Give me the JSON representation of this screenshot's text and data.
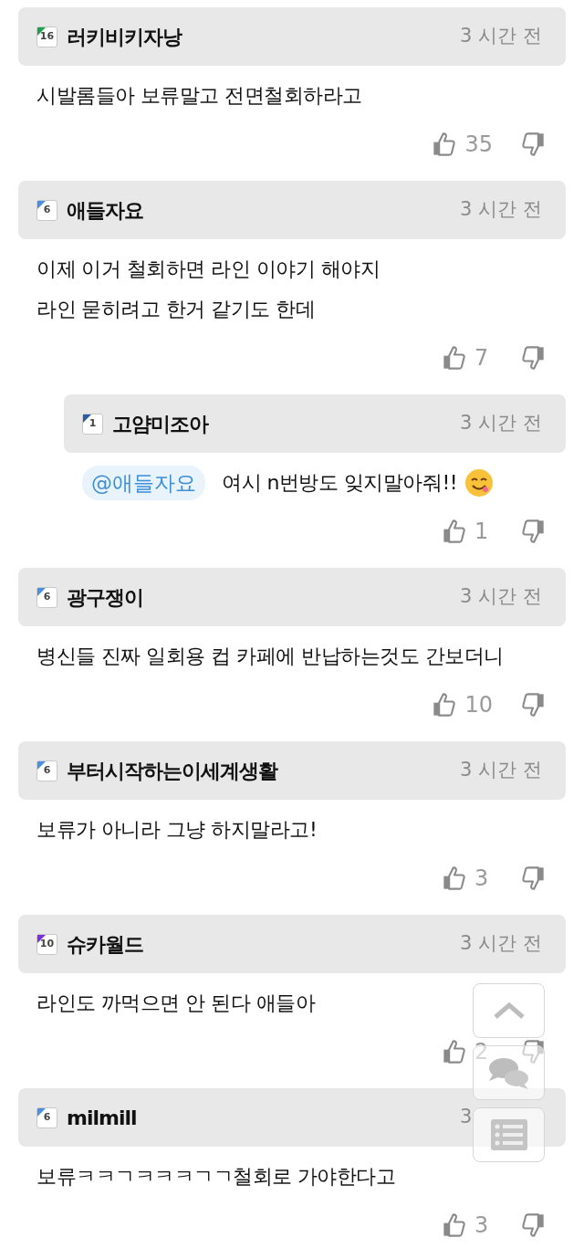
{
  "comments": [
    {
      "kind": "comment",
      "badge": "16",
      "color": "#1aa34a",
      "name": "러키비키자낭",
      "time": "3 시간 전",
      "lines": [
        "시발롬들아 보류말고 전면철회하라고"
      ],
      "likes": "35"
    },
    {
      "kind": "comment",
      "badge": "6",
      "color": "#4a90e2",
      "name": "애들자요",
      "time": "3 시간 전",
      "lines": [
        "이제 이거 철회하면 라인 이야기 해야지",
        "라인 묻히려고 한거 같기도 한데"
      ],
      "likes": "7"
    },
    {
      "kind": "reply",
      "badge": "1",
      "color": "#2a5caa",
      "name": "고얌미조아",
      "time": "3 시간 전",
      "mention": "@애들자요",
      "lines": [
        "여시 n번방도 잊지말아줘!!"
      ],
      "likes": "1",
      "emoji": true
    },
    {
      "kind": "comment",
      "badge": "6",
      "color": "#4a90e2",
      "name": "광구쟁이",
      "time": "3 시간 전",
      "lines": [
        "병신들 진짜 일회용 컵 카페에 반납하는것도 간보더니"
      ],
      "likes": "10"
    },
    {
      "kind": "comment",
      "badge": "6",
      "color": "#4a90e2",
      "name": "부터시작하는이세계생활",
      "time": "3 시간 전",
      "lines": [
        "보류가 아니라 그냥 하지말라고!"
      ],
      "likes": "3"
    },
    {
      "kind": "comment",
      "badge": "10",
      "color": "#7a2ee0",
      "name": "슈카월드",
      "time": "3 시간 전",
      "lines": [
        "라인도 까먹으면 안 된다 애들아"
      ],
      "likes": "2"
    },
    {
      "kind": "comment",
      "badge": "6",
      "color": "#4a90e2",
      "name": "milmill",
      "time": "3",
      "lines": [
        "보류ㅋㅋㄱㅋㅋㅋㄱㄱ철회로 가야한다고"
      ],
      "likes": "3"
    }
  ],
  "floating_buttons": [
    {
      "kind": "up"
    },
    {
      "kind": "chat"
    },
    {
      "kind": "list"
    }
  ]
}
